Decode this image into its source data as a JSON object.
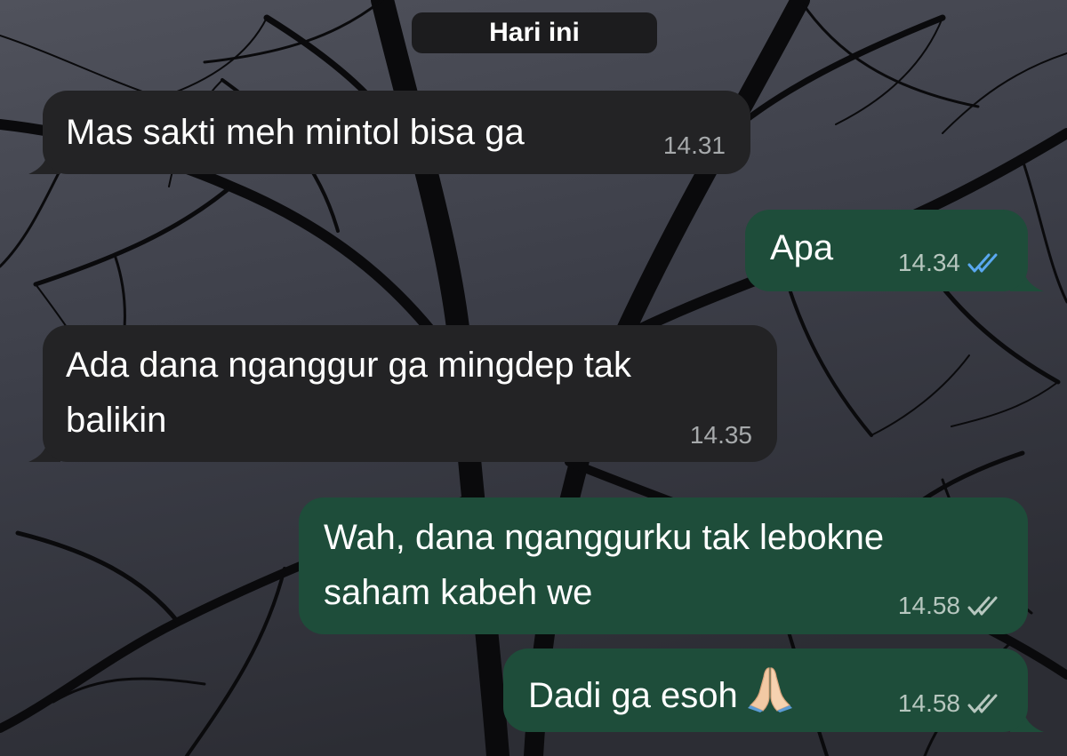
{
  "chat": {
    "date_label": "Hari ini",
    "messages": [
      {
        "direction": "incoming",
        "lines": [
          "Mas sakti meh mintol bisa ga"
        ],
        "time": "14.31"
      },
      {
        "direction": "outgoing",
        "lines": [
          "Apa"
        ],
        "time": "14.34",
        "status": "read",
        "tick_color": "#5aa8f0"
      },
      {
        "direction": "incoming",
        "lines": [
          "Ada dana nganggur ga mingdep tak",
          "balikin"
        ],
        "time": "14.35"
      },
      {
        "direction": "outgoing",
        "lines": [
          "Wah, dana nganggurku tak lebokne",
          "saham kabeh we"
        ],
        "time": "14.58",
        "status": "delivered",
        "tick_color": "#b7c7bf"
      },
      {
        "direction": "outgoing",
        "lines": [
          "Dadi ga esoh"
        ],
        "emoji": "folded-hands",
        "time": "14.58",
        "status": "delivered",
        "tick_color": "#b7c7bf"
      }
    ]
  },
  "colors": {
    "incoming_bubble": "#232325",
    "outgoing_bubble": "#1e4d3a",
    "date_pill": "#1c1c1e",
    "read_ticks": "#5aa8f0"
  }
}
